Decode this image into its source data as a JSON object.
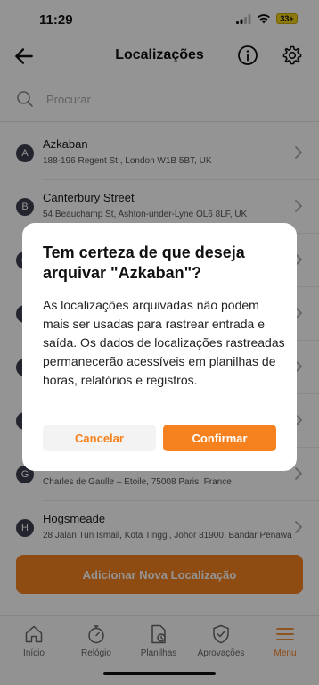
{
  "status_bar": {
    "time": "11:29",
    "battery": "33+"
  },
  "nav": {
    "title": "Localizações"
  },
  "search": {
    "placeholder": "Procurar"
  },
  "locations": [
    {
      "letter": "A",
      "name": "Azkaban",
      "address": "188-196 Regent St., London W1B 5BT, UK"
    },
    {
      "letter": "B",
      "name": "Canterbury Street",
      "address": "54 Beauchamp St, Ashton-under-Lyne OL6 8LF, UK"
    },
    {
      "letter": "C",
      "name": "",
      "address": ""
    },
    {
      "letter": "D",
      "name": "",
      "address": ""
    },
    {
      "letter": "E",
      "name": "",
      "address": ""
    },
    {
      "letter": "F",
      "name": "",
      "address": ""
    },
    {
      "letter": "G",
      "name": "",
      "address": "Charles de Gaulle – Étoile, 75008 Paris, France"
    },
    {
      "letter": "H",
      "name": "Hogsmeade",
      "address": "28 Jalan Tun Ismail, Kota Tinggi, Johor 81900, Bandar Penawar"
    }
  ],
  "add_button": {
    "label": "Adicionar Nova Localização"
  },
  "tabs": [
    {
      "label": "Início",
      "icon": "home-icon"
    },
    {
      "label": "Relógio",
      "icon": "stopwatch-icon"
    },
    {
      "label": "Planilhas",
      "icon": "document-clock-icon"
    },
    {
      "label": "Aprovações",
      "icon": "shield-check-icon"
    },
    {
      "label": "Menu",
      "icon": "menu-icon"
    }
  ],
  "dialog": {
    "title": "Tem certeza de que deseja arquivar \"Azkaban\"?",
    "body": "As localizações arquivadas não podem mais ser usadas para rastrear entrada e saída. Os dados de localizações rastreadas permanecerão acessíveis em planilhas de horas, relatórios e registros.",
    "cancel_label": "Cancelar",
    "confirm_label": "Confirmar"
  },
  "colors": {
    "accent": "#f5821f",
    "badge": "#3b4150"
  }
}
